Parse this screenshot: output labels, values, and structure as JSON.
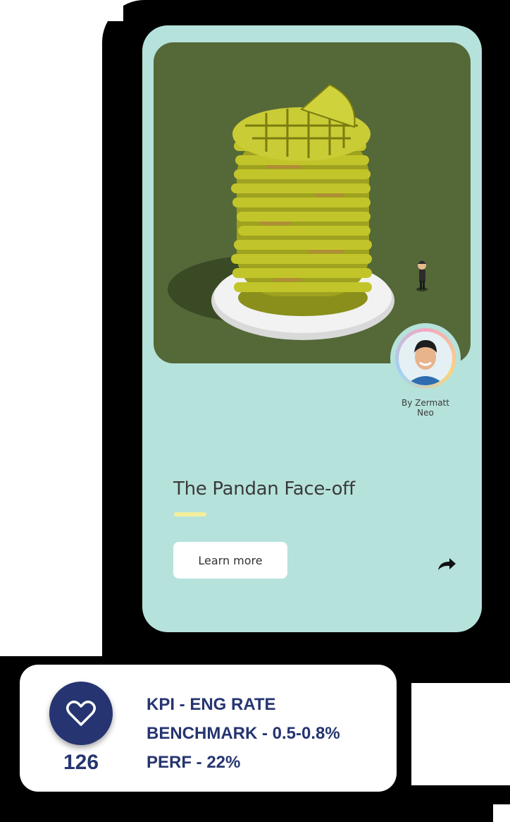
{
  "post": {
    "title": "The Pandan Face-off",
    "author": "By Zermatt\nNeo",
    "cta_label": "Learn more",
    "share_icon": "share-arrow-icon"
  },
  "kpi": {
    "likes_count": "126",
    "like_icon": "heart-outline-icon",
    "lines": [
      "KPI - ENG RATE",
      "BENCHMARK - 0.5-0.8%",
      "PERF - 22%"
    ]
  },
  "colors": {
    "card_bg": "#b6e2dc",
    "hero_bg": "#556838",
    "accent_underline": "#f4ef9c",
    "navy": "#263571"
  }
}
